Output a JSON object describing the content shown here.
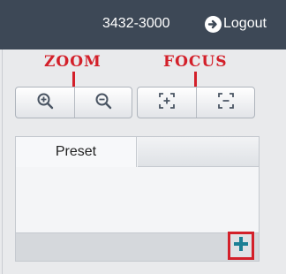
{
  "header": {
    "phone": "3432-3000",
    "logout_label": "Logout"
  },
  "annotations": {
    "zoom": "ZOOM",
    "focus": "FOCUS"
  },
  "zoom_controls": {
    "buttons": [
      {
        "icon": "zoom-in-icon"
      },
      {
        "icon": "zoom-out-icon"
      }
    ]
  },
  "focus_controls": {
    "buttons": [
      {
        "icon": "focus-near-icon"
      },
      {
        "icon": "focus-far-icon"
      }
    ]
  },
  "preset_panel": {
    "tabs": [
      {
        "label": "Preset"
      },
      {
        "label": ""
      }
    ],
    "add_icon": "plus-icon"
  },
  "colors": {
    "header_bg": "#3d4856",
    "annotation_red": "#d3202a",
    "add_icon": "#1b7f95"
  }
}
